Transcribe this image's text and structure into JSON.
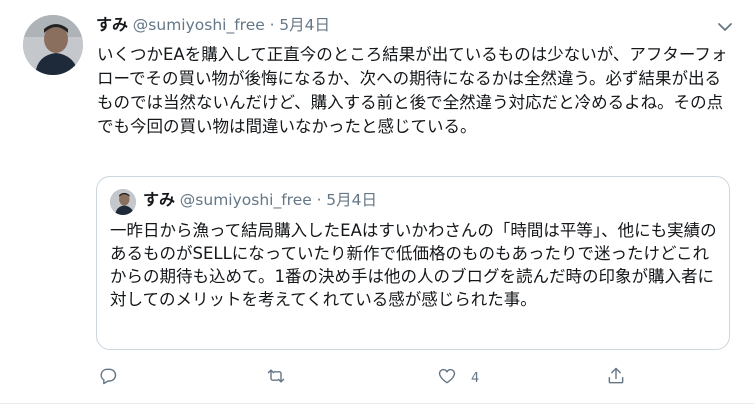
{
  "tweet": {
    "name": "すみ",
    "handle": "@sumiyoshi_free",
    "separator": "·",
    "date": "5月4日",
    "text": "いくつかEAを購入して正直今のところ結果が出ているものは少ないが、アフターフォローでその買い物が後悔になるか、次への期待になるかは全然違う。必ず結果が出るものでは当然ないんだけど、購入する前と後で全然違う対応だと冷めるよね。その点でも今回の買い物は間違いなかったと感じている。"
  },
  "quoted": {
    "name": "すみ",
    "handle": "@sumiyoshi_free",
    "separator": "·",
    "date": "5月4日",
    "text": "一昨日から漁って結局購入したEAはすいかわさんの「時間は平等」、他にも実績のあるものがSELLになっていたり新作で低価格のものもあったりで迷ったけどこれからの期待も込めて。1番の決め手は他の人のブログを読んだ時の印象が購入者に対してのメリットを考えてくれている感が感じられた事。"
  },
  "actions": {
    "reply_icon": "reply-icon",
    "retweet_icon": "retweet-icon",
    "like_icon": "like-icon",
    "like_count": "4",
    "share_icon": "share-icon"
  },
  "colors": {
    "text": "#14171a",
    "secondary": "#657786",
    "border": "#ccd6dd"
  }
}
